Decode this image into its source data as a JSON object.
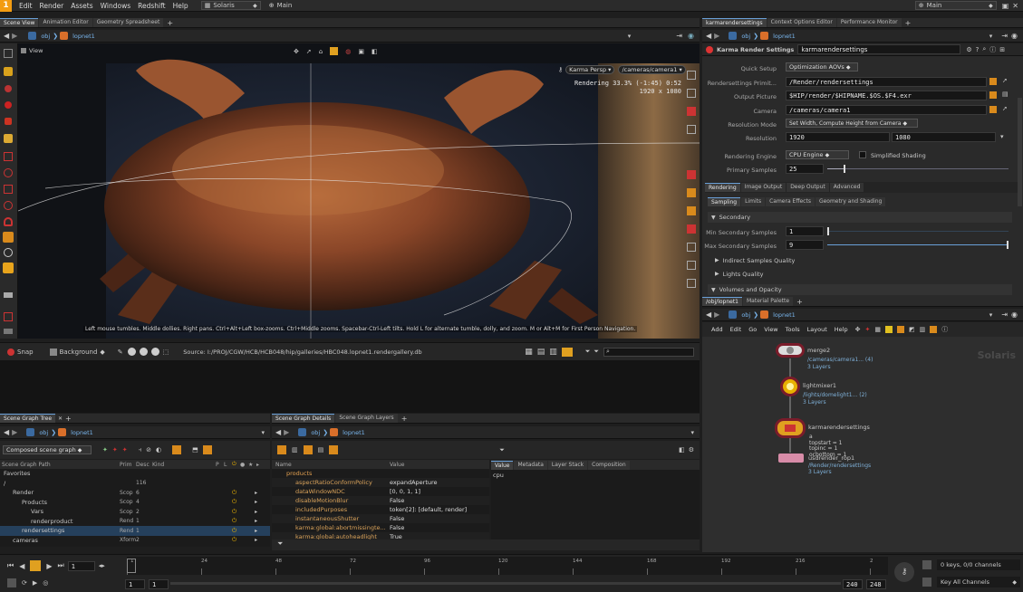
{
  "menubar": {
    "logo": "1",
    "items": [
      "Edit",
      "Render",
      "Assets",
      "Windows",
      "Redshift",
      "Help"
    ],
    "desktop": "Solaris",
    "context": "Main",
    "right_context": "Main"
  },
  "viewer_tabs": [
    "Scene View",
    "Animation Editor",
    "Geometry Spreadsheet"
  ],
  "path": {
    "root": "obj",
    "node": "lopnet1"
  },
  "viewport": {
    "label": "View",
    "camera_menu": "Karma Persp",
    "camera_path": "/cameras/camera1",
    "render_stats": "Rendering  33.3%  (-1:45)  0:52",
    "resolution": "1920 x 1080",
    "help_text": "Left mouse tumbles. Middle dollies. Right pans. Ctrl+Alt+Left box-zooms. Ctrl+Middle zooms. Spacebar-Ctrl-Left tilts. Hold L for alternate tumble, dolly, and zoom.    M or Alt+M for First Person Navigation."
  },
  "viewer_footer": {
    "snap": "Snap",
    "background": "Background",
    "source": "Source: I:/PROJ/CGW/HCB/HCB048/hip/galleries/HBC048.lopnet1.rendergallery.db"
  },
  "params_tabs": [
    "karmarendersettings",
    "Context Options Editor",
    "Performance Monitor"
  ],
  "params": {
    "node_type": "Karma Render Settings",
    "node_name": "karmarendersettings",
    "quick_setup_label": "Quick Setup",
    "quick_setup_value": "Optimization AOVs",
    "rs_prim_label": "Rendersettings Primit...",
    "rs_prim_value": "/Render/rendersettings",
    "output_label": "Output Picture",
    "output_value": "$HIP/render/$HIPNAME.$OS.$F4.exr",
    "camera_label": "Camera",
    "camera_value": "/cameras/camera1",
    "res_mode_label": "Resolution Mode",
    "res_mode_value": "Set Width, Compute Height from Camera",
    "resolution_label": "Resolution",
    "res_w": "1920",
    "res_h": "1080",
    "engine_label": "Rendering Engine",
    "engine_value": "CPU Engine",
    "simplified_label": "Simplified Shading",
    "primary_label": "Primary Samples",
    "primary_value": "25",
    "primary_fill": 0.1,
    "main_tabs": [
      "Rendering",
      "Image Output",
      "Deep Output",
      "Advanced"
    ],
    "sub_tabs": [
      "Sampling",
      "Limits",
      "Camera Effects",
      "Geometry and Shading"
    ],
    "secondary_header": "Secondary",
    "min_sec_label": "Min Secondary Samples",
    "min_sec_value": "1",
    "min_sec_fill": 0.0,
    "max_sec_label": "Max Secondary Samples",
    "max_sec_value": "9",
    "max_sec_fill": 1.0,
    "indirect_label": "Indirect Samples Quality",
    "lights_label": "Lights Quality",
    "volumes_label": "Volumes and Opacity"
  },
  "network_tabs": [
    "/obj/lopnet1",
    "Material Palette"
  ],
  "network": {
    "menu": [
      "Add",
      "Edit",
      "Go",
      "View",
      "Tools",
      "Layout",
      "Help"
    ],
    "watermark": "Solaris",
    "nodes": [
      {
        "name": "merge2",
        "info1": "/cameras/camera1... (4)",
        "info2": "3 Layers"
      },
      {
        "name": "lightmixer1",
        "info1": "/lights/domelight1... (2)",
        "info2": "3 Layers"
      },
      {
        "name": "karmarendersettings",
        "info1": "",
        "info2": ""
      },
      {
        "name": "usdrender_rop1",
        "info1": "/Render/rendersettings",
        "info2": "3 Layers"
      }
    ],
    "ks_info": [
      "topstart = 1",
      "topinc = 1",
      "ocbottom = 1"
    ],
    "ks_letter": "a"
  },
  "sgt": {
    "tabs": [
      "Scene Graph Tree"
    ],
    "dropdown": "Composed scene graph",
    "columns": [
      "Scene Graph Path",
      "Prim",
      "Desc",
      "Kind",
      "P",
      "L"
    ],
    "rows": [
      {
        "name": "Favorites",
        "prim": "",
        "desc": "",
        "indent": 0
      },
      {
        "name": "/",
        "prim": "",
        "desc": "116",
        "indent": 0
      },
      {
        "name": "Render",
        "prim": "Scop",
        "desc": "6",
        "indent": 1
      },
      {
        "name": "Products",
        "prim": "Scop",
        "desc": "4",
        "indent": 2
      },
      {
        "name": "Vars",
        "prim": "Scop",
        "desc": "2",
        "indent": 3
      },
      {
        "name": "renderproduct",
        "prim": "Rend",
        "desc": "1",
        "indent": 3
      },
      {
        "name": "rendersettings",
        "prim": "Rend",
        "desc": "1",
        "indent": 2
      },
      {
        "name": "cameras",
        "prim": "Xform",
        "desc": "2",
        "indent": 1
      }
    ]
  },
  "sgd": {
    "tabs": [
      "Scene Graph Details",
      "Scene Graph Layers"
    ],
    "columns": [
      "Name",
      "Value"
    ],
    "rows": [
      {
        "name": "products",
        "value": ""
      },
      {
        "name": "aspectRatioConformPolicy",
        "value": "expandAperture"
      },
      {
        "name": "dataWindowNDC",
        "value": "[0, 0, 1, 1]"
      },
      {
        "name": "disableMotionBlur",
        "value": "False"
      },
      {
        "name": "includedPurposes",
        "value": "token[2]: [default, render]"
      },
      {
        "name": "instantaneousShutter",
        "value": "False"
      },
      {
        "name": "karma:global:abortmissingte...",
        "value": "False"
      },
      {
        "name": "karma:global:autoheadlight",
        "value": "True"
      }
    ],
    "right_tabs": [
      "Value",
      "Metadata",
      "Layer Stack",
      "Composition"
    ],
    "right_value": "cpu"
  },
  "timeline": {
    "frame": "1",
    "ticks": [
      "1",
      "24",
      "48",
      "72",
      "96",
      "120",
      "144",
      "168",
      "192",
      "216",
      "2"
    ],
    "start": "1",
    "start2": "1",
    "end": "240",
    "end2": "248",
    "keys": "0 keys, 0/0 channels",
    "key_all": "Key All Channels"
  }
}
